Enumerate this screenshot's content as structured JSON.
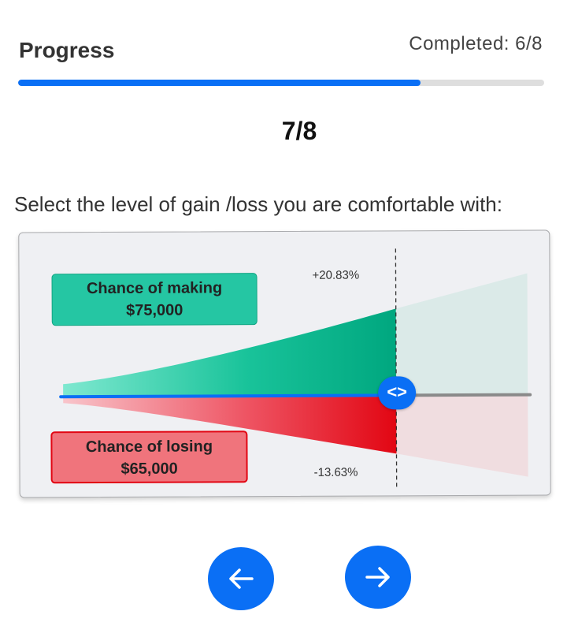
{
  "header": {
    "title": "Progress",
    "completed_text": "Completed: 6/8",
    "progress_fraction": 0.765
  },
  "step_label": "7/8",
  "question": "Select the level of gain /loss you are comfortable with:",
  "risk_slider": {
    "gain_percent_label": "+20.83%",
    "loss_percent_label": "-13.63%",
    "gain_box": {
      "line1": "Chance of making",
      "line2": "$75,000"
    },
    "loss_box": {
      "line1": "Chance of losing",
      "line2": "$65,000"
    },
    "handle_symbol": "<>",
    "slider_fraction": 0.72,
    "colors": {
      "gain": "#00b38a",
      "loss": "#e20613",
      "track": "#0a6ff5",
      "inactive_track": "#8a8a8a"
    }
  },
  "nav": {
    "prev_icon": "arrow-left-icon",
    "next_icon": "arrow-right-icon"
  }
}
